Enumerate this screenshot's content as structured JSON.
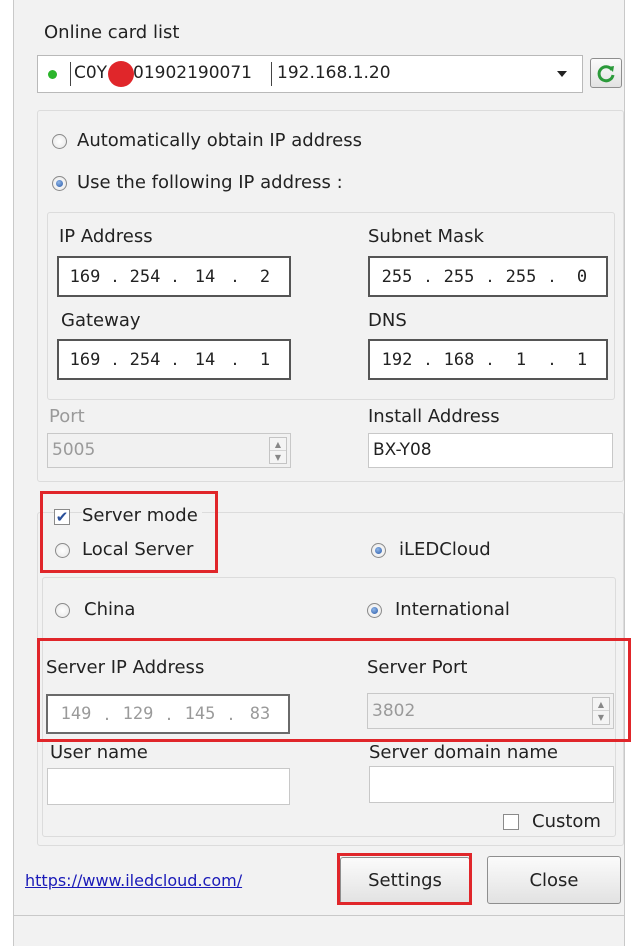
{
  "online_card_list": {
    "label": "Online card list",
    "card_id": "C0Y",
    "card_id_rest": "01902190071",
    "card_ip": "192.168.1.20"
  },
  "ip_mode": {
    "auto_label": "Automatically obtain IP address",
    "manual_label": "Use the following IP address :",
    "selected": "manual"
  },
  "network": {
    "ip_label": "IP Address",
    "ip": [
      "169",
      "254",
      "14",
      "2"
    ],
    "subnet_label": "Subnet Mask",
    "subnet": [
      "255",
      "255",
      "255",
      "0"
    ],
    "gateway_label": "Gateway",
    "gateway": [
      "169",
      "254",
      "14",
      "1"
    ],
    "dns_label": "DNS",
    "dns": [
      "192",
      "168",
      "1",
      "1"
    ],
    "port_label": "Port",
    "port": "5005",
    "install_label": "Install Address",
    "install_address": "BX-Y08"
  },
  "server": {
    "mode_label": "Server mode",
    "mode_checked": true,
    "local_label": "Local Server",
    "cloud_label": "iLEDCloud",
    "selected": "iLEDCloud",
    "china_label": "China",
    "international_label": "International",
    "region": "International",
    "ip_label": "Server IP Address",
    "ip": [
      "149",
      "129",
      "145",
      "83"
    ],
    "port_label": "Server Port",
    "port": "3802",
    "user_label": "User name",
    "user_value": "",
    "domain_label": "Server domain name",
    "domain_value": "",
    "custom_label": "Custom",
    "custom_checked": false
  },
  "footer": {
    "link": "https://www.iledcloud.com/",
    "settings_label": "Settings",
    "close_label": "Close"
  },
  "colors": {
    "highlight": "#e0262a",
    "status_dot": "#2bb52b",
    "link": "#1a1ab8"
  },
  "icons": {
    "refresh": "refresh-icon",
    "dropdown": "dropdown-arrow-icon"
  }
}
